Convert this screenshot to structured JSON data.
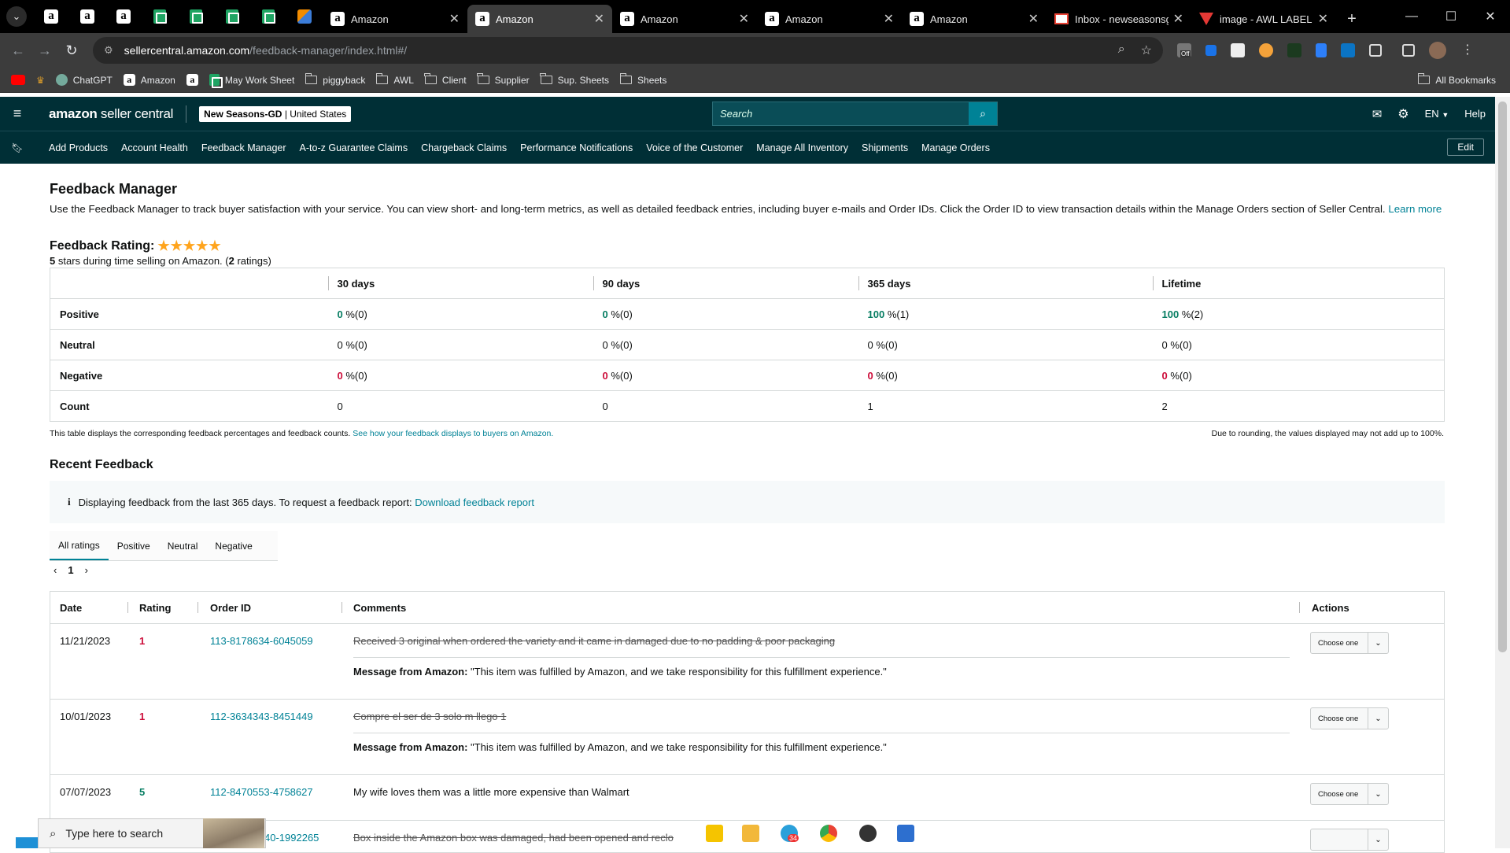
{
  "browser": {
    "tabs": [
      {
        "title": "Amazon",
        "active": false
      },
      {
        "title": "Amazon",
        "active": true
      },
      {
        "title": "Amazon",
        "active": false
      },
      {
        "title": "Amazon",
        "active": false
      },
      {
        "title": "Amazon",
        "active": false
      },
      {
        "title": "Inbox - newseasonsg",
        "active": false
      },
      {
        "title": "image - AWL LABEL",
        "active": false
      }
    ],
    "url_host": "sellercentral.amazon.com",
    "url_path": "/feedback-manager/index.html#/",
    "bookmarks": [
      "ChatGPT",
      "Amazon",
      "May Work Sheet",
      "piggyback",
      "AWL",
      "Client",
      "Supplier",
      "Sup. Sheets",
      "Sheets"
    ],
    "all_bookmarks": "All Bookmarks",
    "extension_badge": "Off"
  },
  "header": {
    "logo_bold": "amazon",
    "logo_rest": " seller central",
    "store_name": "New Seasons-GD",
    "store_country": " | United States",
    "search_placeholder": "Search",
    "lang": "EN",
    "help": "Help"
  },
  "nav": {
    "items": [
      "Add Products",
      "Account Health",
      "Feedback Manager",
      "A-to-z Guarantee Claims",
      "Chargeback Claims",
      "Performance Notifications",
      "Voice of the Customer",
      "Manage All Inventory",
      "Shipments",
      "Manage Orders"
    ],
    "edit": "Edit"
  },
  "page": {
    "title": "Feedback Manager",
    "description": "Use the Feedback Manager to track buyer satisfaction with your service. You can view short- and long-term metrics, as well as detailed feedback entries, including buyer e-mails and Order IDs. Click the Order ID to view transaction details within the Manage Orders section of Seller Central.",
    "learn_more": "Learn more",
    "rating_label": "Feedback Rating:",
    "stars": "★★★★★",
    "rating_value": 5,
    "rating_sub_value": "5",
    "rating_sub_text": " stars during time selling on Amazon. (",
    "rating_count": "2",
    "rating_sub_end": " ratings)"
  },
  "metrics": {
    "columns": [
      "30 days",
      "90 days",
      "365 days",
      "Lifetime"
    ],
    "rows": [
      {
        "label": "Positive",
        "cells": [
          {
            "v": "0",
            "s": " %(0)"
          },
          {
            "v": "0",
            "s": " %(0)"
          },
          {
            "v": "100",
            "s": " %(1)"
          },
          {
            "v": "100",
            "s": " %(2)"
          }
        ]
      },
      {
        "label": "Neutral",
        "cells": [
          {
            "v": "0",
            "s": " %(0)"
          },
          {
            "v": "0",
            "s": " %(0)"
          },
          {
            "v": "0",
            "s": " %(0)"
          },
          {
            "v": "0",
            "s": " %(0)"
          }
        ]
      },
      {
        "label": "Negative",
        "cells": [
          {
            "v": "0",
            "s": " %(0)"
          },
          {
            "v": "0",
            "s": " %(0)"
          },
          {
            "v": "0",
            "s": " %(0)"
          },
          {
            "v": "0",
            "s": " %(0)"
          }
        ]
      },
      {
        "label": "Count",
        "cells": [
          {
            "v": "0",
            "s": ""
          },
          {
            "v": "0",
            "s": ""
          },
          {
            "v": "1",
            "s": ""
          },
          {
            "v": "2",
            "s": ""
          }
        ]
      }
    ],
    "note": "This table displays the corresponding feedback percentages and feedback counts.",
    "note_link": "See how your feedback displays to buyers on Amazon.",
    "note_right": "Due to rounding, the values displayed may not add up to 100%."
  },
  "recent": {
    "title": "Recent Feedback",
    "info": "Displaying feedback from the last 365 days. To request a feedback report:",
    "info_link": "Download feedback report",
    "tabs": [
      "All ratings",
      "Positive",
      "Neutral",
      "Negative"
    ],
    "page": "1",
    "columns": [
      "Date",
      "Rating",
      "Order ID",
      "Comments",
      "Actions"
    ],
    "rows": [
      {
        "date": "11/21/2023",
        "rating": "1",
        "order": "113-8178634-6045059",
        "comment": "Received 3 original when ordered the variety and it came in damaged due to no padding & poor packaging",
        "struck": true,
        "msg_label": "Message from Amazon:",
        "msg": " \"This item was fulfilled by Amazon, and we take responsibility for this fulfillment experience.\"",
        "action": "Choose one"
      },
      {
        "date": "10/01/2023",
        "rating": "1",
        "order": "112-3634343-8451449",
        "comment": "Compre el ser de 3 solo m llego 1",
        "struck": true,
        "msg_label": "Message from Amazon:",
        "msg": " \"This item was fulfilled by Amazon, and we take responsibility for this fulfillment experience.\"",
        "action": "Choose one"
      },
      {
        "date": "07/07/2023",
        "rating": "5",
        "order": "112-8470553-4758627",
        "comment": "My wife loves them was a little more expensive than Walmart",
        "struck": false,
        "action": "Choose one"
      },
      {
        "order_partial": "40-1992265",
        "comment": "Box inside the Amazon box was damaged, had been opened and reclo",
        "struck": true
      }
    ]
  },
  "taskbar": {
    "search_placeholder": "Type here to search",
    "badge": "34"
  },
  "colors": {
    "header_bg": "#002f36",
    "link": "#008296",
    "positive": "#067d62",
    "negative": "#cc0c39",
    "star": "#ffa41c"
  }
}
